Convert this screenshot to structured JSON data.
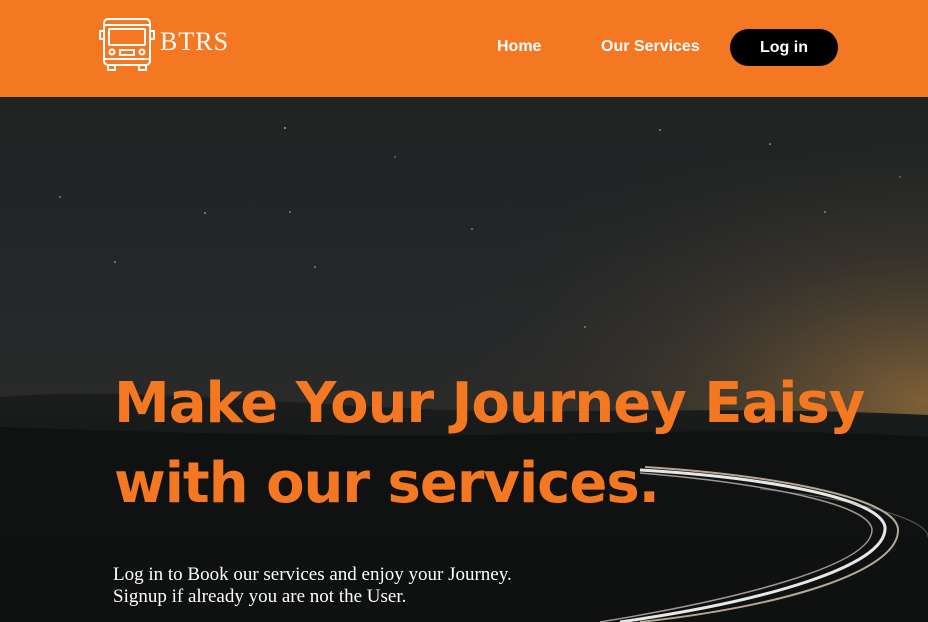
{
  "header": {
    "brand": "BTRS",
    "logo_icon": "bus-icon",
    "nav": [
      {
        "label": "Home"
      },
      {
        "label": "Our Services"
      }
    ],
    "login_label": "Log in",
    "color": "#f47722"
  },
  "hero": {
    "title_line1": "Make Your Journey Eaisy",
    "title_line2": "with our services.",
    "sub_line1": "Log in to Book our services and enjoy your Journey.",
    "sub_line2": "Signup if already you are not the User.",
    "accent_color": "#f47722"
  }
}
